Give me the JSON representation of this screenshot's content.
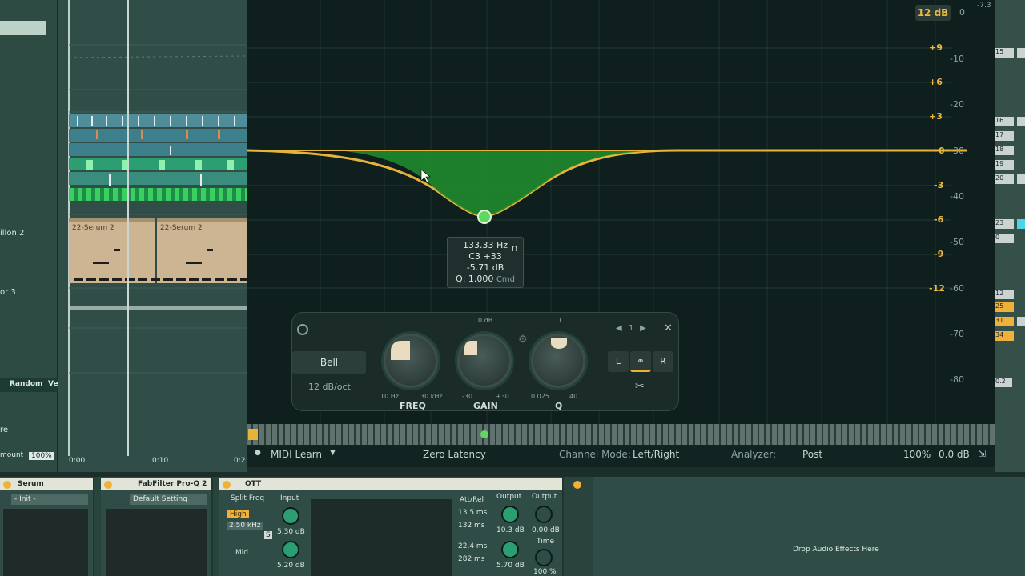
{
  "left_browser": {
    "items": [
      {
        "label": "illon 2"
      },
      {
        "label": "or 3"
      }
    ],
    "random_label": "Random",
    "ve_label": "Ve",
    "list": [
      {
        "label": "re"
      }
    ],
    "amount_label": "mount",
    "amount_value": "100%"
  },
  "arrangement": {
    "clips": [
      {
        "name": "22-Serum 2"
      },
      {
        "name": "22-Serum 2"
      }
    ],
    "timeline": [
      "0:00",
      "0:10",
      "0:2"
    ]
  },
  "eq": {
    "range": "12 dB",
    "gain_scale": [
      "+9",
      "+6",
      "+3",
      "0",
      "-3",
      "-6",
      "-9",
      "-12"
    ],
    "analyzer_scale": [
      "0",
      "-10",
      "-20",
      "-30",
      "-40",
      "-50",
      "-60",
      "-70",
      "-80"
    ],
    "peak": "-7.3",
    "tooltip": {
      "freq": "133.33 Hz",
      "note": "C3 +33",
      "gain": "-5.71 dB",
      "q": "Q: 1.000",
      "modifier": "Cmd"
    },
    "band": {
      "shape": "Bell",
      "slope": "12 dB/oct",
      "nav_index": "1",
      "knobs": [
        {
          "label": "FREQ",
          "min": "10 Hz",
          "max": "30 kHz",
          "top": ""
        },
        {
          "label": "GAIN",
          "min": "-30",
          "max": "+30",
          "top": "0 dB"
        },
        {
          "label": "Q",
          "min": "0.025",
          "max": "40",
          "top": "1"
        }
      ],
      "channels": [
        "L",
        "",
        "R"
      ]
    },
    "status": {
      "midi": "MIDI Learn",
      "latency": "Zero Latency",
      "channel_mode_label": "Channel Mode:",
      "channel_mode_value": "Left/Right",
      "analyzer_label": "Analyzer:",
      "analyzer_value": "Post",
      "zoom": "100%",
      "output": "0.0 dB"
    }
  },
  "mixer": {
    "values": [
      "15",
      "16",
      "17",
      "18",
      "19",
      "20",
      "23",
      "0",
      "12",
      "25",
      "31",
      "34",
      "0.2"
    ]
  },
  "devices": {
    "serum": {
      "title": "Serum",
      "preset": "- Init -"
    },
    "proq": {
      "title": "FabFilter Pro-Q 2",
      "preset": "Default Setting"
    },
    "ott": {
      "title": "OTT",
      "split_freq": "Split Freq",
      "high": "High",
      "high_freq": "2.50 kHz",
      "mid": "Mid",
      "input": "Input",
      "input_high": "5.30 dB",
      "input_mid": "5.20 dB",
      "att_rel": "Att/Rel",
      "att1": "13.5 ms",
      "rel1": "132 ms",
      "att2": "22.4 ms",
      "rel2": "282 ms",
      "output_label": "Output",
      "output_label2": "Output",
      "out_high": "10.3 dB",
      "out_mid": "5.70 dB",
      "out_main": "0.00 dB",
      "time": "Time",
      "time_value": "100 %",
      "s": "S"
    },
    "drop": "Drop Audio Effects Here"
  }
}
